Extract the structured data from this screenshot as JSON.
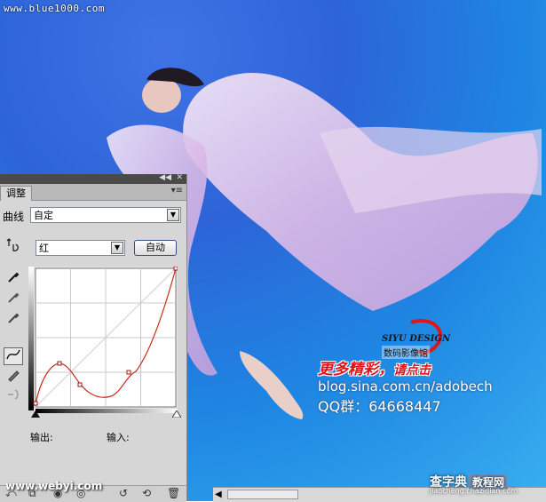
{
  "watermarks": {
    "top_left": "www.blue1000.com",
    "bottom_left": "www.webyi.com",
    "bottom_right_main": "查字典",
    "bottom_right_badge": "教程网",
    "bottom_right_sub": "jiaocheng.chazidian.com"
  },
  "signature": {
    "brand": "SIYU DESIGN",
    "brand_cn": "数码影像馆",
    "more": "更多精彩，",
    "click": "请点击",
    "blog": "blog.sina.com.cn/adobech",
    "qq": "QQ群：64668447"
  },
  "panel": {
    "tab_label": "调整",
    "curve_label": "曲线",
    "preset_value": "自定",
    "channel_value": "红",
    "auto_button": "自动",
    "output_label": "输出:",
    "input_label": "输入:"
  },
  "icons": {
    "hand_adjust": "finger-adjust-icon",
    "eyedropper_black": "eyedropper-black-icon",
    "eyedropper_gray": "eyedropper-gray-icon",
    "eyedropper_white": "eyedropper-white-icon",
    "curve_mode": "curve-point-icon",
    "pencil_mode": "pencil-icon",
    "smooth": "smooth-icon"
  },
  "curve": {
    "channel_color": "#cc2a1a",
    "points": [
      [
        0,
        0
      ],
      [
        41,
        87
      ],
      [
        80,
        31
      ],
      [
        167,
        77
      ],
      [
        255,
        255
      ]
    ]
  }
}
